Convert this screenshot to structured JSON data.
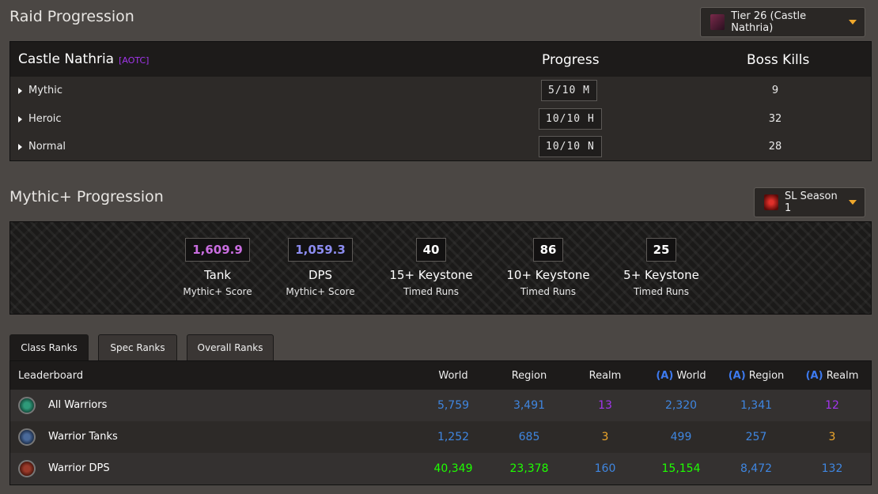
{
  "raid_section": {
    "title": "Raid Progression",
    "tier_dropdown": "Tier 26 (Castle Nathria)",
    "raid_name": "Castle Nathria",
    "raid_tag": "[AOTC]",
    "col_progress": "Progress",
    "col_kills": "Boss Kills",
    "rows": [
      {
        "difficulty": "Mythic",
        "progress": "5/10 M",
        "kills": "9"
      },
      {
        "difficulty": "Heroic",
        "progress": "10/10 H",
        "kills": "32"
      },
      {
        "difficulty": "Normal",
        "progress": "10/10 N",
        "kills": "28"
      }
    ]
  },
  "mplus_section": {
    "title": "Mythic+ Progression",
    "season_dropdown": "SL Season 1",
    "stats": [
      {
        "value": "1,609.9",
        "label": "Tank",
        "sub": "Mythic+ Score",
        "color": "#c96de0"
      },
      {
        "value": "1,059.3",
        "label": "DPS",
        "sub": "Mythic+ Score",
        "color": "#8c8cf0"
      },
      {
        "value": "40",
        "label": "15+ Keystone",
        "sub": "Timed Runs",
        "color": "#ffffff"
      },
      {
        "value": "86",
        "label": "10+ Keystone",
        "sub": "Timed Runs",
        "color": "#ffffff"
      },
      {
        "value": "25",
        "label": "5+ Keystone",
        "sub": "Timed Runs",
        "color": "#ffffff"
      }
    ]
  },
  "rank_tabs": [
    "Class Ranks",
    "Spec Ranks",
    "Overall Ranks"
  ],
  "ranks": {
    "headers": {
      "leaderboard": "Leaderboard",
      "world": "World",
      "region": "Region",
      "realm": "Realm",
      "alliance_tag": "(A)",
      "a_world": "World",
      "a_region": "Region",
      "a_realm": "Realm"
    },
    "rows": [
      {
        "name": "All Warriors",
        "world": "5,759",
        "region": "3,491",
        "realm": "13",
        "a_world": "2,320",
        "a_region": "1,341",
        "a_realm": "12"
      },
      {
        "name": "Warrior Tanks",
        "world": "1,252",
        "region": "685",
        "realm": "3",
        "a_world": "499",
        "a_region": "257",
        "a_realm": "3"
      },
      {
        "name": "Warrior DPS",
        "world": "40,349",
        "region": "23,378",
        "realm": "160",
        "a_world": "15,154",
        "a_region": "8,472",
        "a_realm": "132"
      }
    ],
    "colors": {
      "blue": "#3f86e0",
      "purple": "#a335ee",
      "orange": "#f0a82b",
      "green": "#1eff00"
    }
  }
}
